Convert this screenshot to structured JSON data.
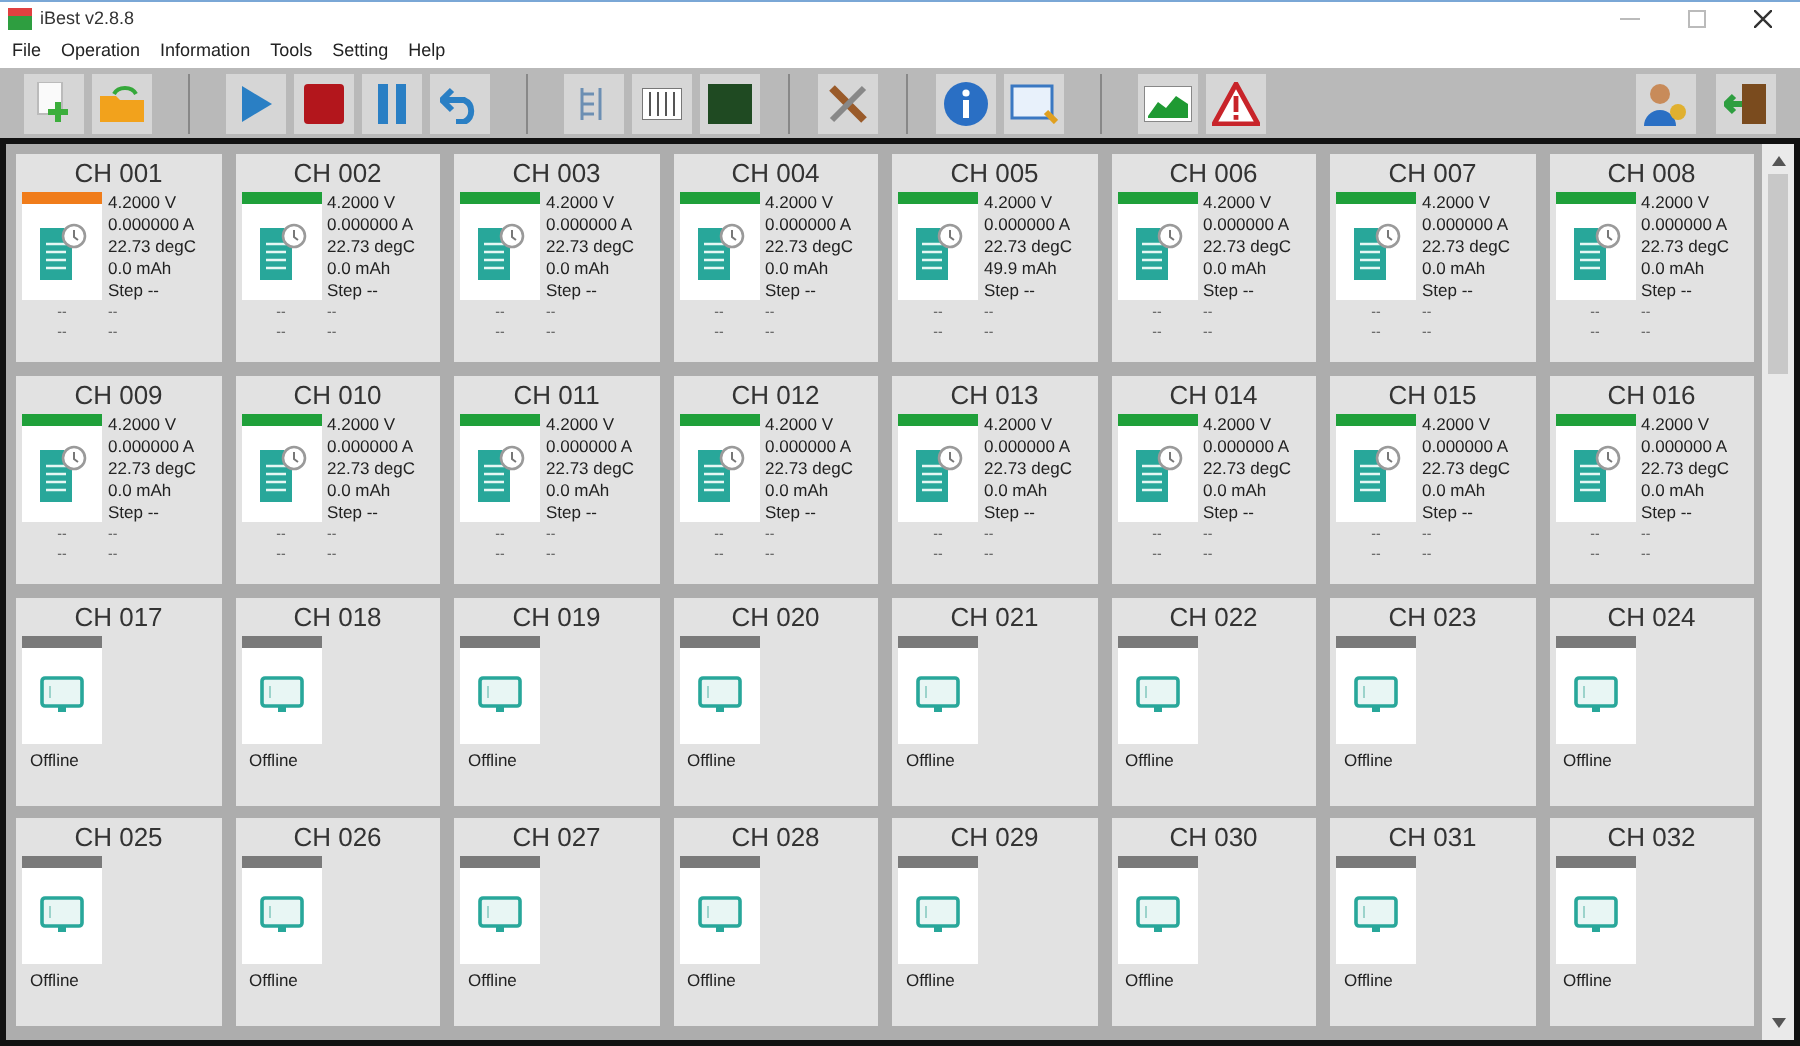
{
  "window": {
    "title": "iBest v2.8.8"
  },
  "menu": [
    "File",
    "Operation",
    "Information",
    "Tools",
    "Setting",
    "Help"
  ],
  "channels": [
    {
      "name": "CH 001",
      "kind": "online",
      "color": "#f07c1a",
      "lines": [
        "4.2000 V",
        "0.000000 A",
        "22.73 degC",
        "0.0 mAh",
        "Step --"
      ],
      "extra": [
        "--",
        "--",
        "--",
        "--"
      ]
    },
    {
      "name": "CH 002",
      "kind": "online",
      "color": "#1fa03a",
      "lines": [
        "4.2000 V",
        "0.000000 A",
        "22.73 degC",
        "0.0 mAh",
        "Step --"
      ],
      "extra": [
        "--",
        "--",
        "--",
        "--"
      ]
    },
    {
      "name": "CH 003",
      "kind": "online",
      "color": "#1fa03a",
      "lines": [
        "4.2000 V",
        "0.000000 A",
        "22.73 degC",
        "0.0 mAh",
        "Step --"
      ],
      "extra": [
        "--",
        "--",
        "--",
        "--"
      ]
    },
    {
      "name": "CH 004",
      "kind": "online",
      "color": "#1fa03a",
      "lines": [
        "4.2000 V",
        "0.000000 A",
        "22.73 degC",
        "0.0 mAh",
        "Step --"
      ],
      "extra": [
        "--",
        "--",
        "--",
        "--"
      ]
    },
    {
      "name": "CH 005",
      "kind": "online",
      "color": "#1fa03a",
      "lines": [
        "4.2000 V",
        "0.000000 A",
        "22.73 degC",
        "49.9 mAh",
        "Step --"
      ],
      "extra": [
        "--",
        "--",
        "--",
        "--"
      ]
    },
    {
      "name": "CH 006",
      "kind": "online",
      "color": "#1fa03a",
      "lines": [
        "4.2000 V",
        "0.000000 A",
        "22.73 degC",
        "0.0 mAh",
        "Step --"
      ],
      "extra": [
        "--",
        "--",
        "--",
        "--"
      ]
    },
    {
      "name": "CH 007",
      "kind": "online",
      "color": "#1fa03a",
      "lines": [
        "4.2000 V",
        "0.000000 A",
        "22.73 degC",
        "0.0 mAh",
        "Step --"
      ],
      "extra": [
        "--",
        "--",
        "--",
        "--"
      ]
    },
    {
      "name": "CH 008",
      "kind": "online",
      "color": "#1fa03a",
      "lines": [
        "4.2000 V",
        "0.000000 A",
        "22.73 degC",
        "0.0 mAh",
        "Step --"
      ],
      "extra": [
        "--",
        "--",
        "--",
        "--"
      ]
    },
    {
      "name": "CH 009",
      "kind": "online",
      "color": "#1fa03a",
      "lines": [
        "4.2000 V",
        "0.000000 A",
        "22.73 degC",
        "0.0 mAh",
        "Step --"
      ],
      "extra": [
        "--",
        "--",
        "--",
        "--"
      ]
    },
    {
      "name": "CH 010",
      "kind": "online",
      "color": "#1fa03a",
      "lines": [
        "4.2000 V",
        "0.000000 A",
        "22.73 degC",
        "0.0 mAh",
        "Step --"
      ],
      "extra": [
        "--",
        "--",
        "--",
        "--"
      ]
    },
    {
      "name": "CH 011",
      "kind": "online",
      "color": "#1fa03a",
      "lines": [
        "4.2000 V",
        "0.000000 A",
        "22.73 degC",
        "0.0 mAh",
        "Step --"
      ],
      "extra": [
        "--",
        "--",
        "--",
        "--"
      ]
    },
    {
      "name": "CH 012",
      "kind": "online",
      "color": "#1fa03a",
      "lines": [
        "4.2000 V",
        "0.000000 A",
        "22.73 degC",
        "0.0 mAh",
        "Step --"
      ],
      "extra": [
        "--",
        "--",
        "--",
        "--"
      ]
    },
    {
      "name": "CH 013",
      "kind": "online",
      "color": "#1fa03a",
      "lines": [
        "4.2000 V",
        "0.000000 A",
        "22.73 degC",
        "0.0 mAh",
        "Step --"
      ],
      "extra": [
        "--",
        "--",
        "--",
        "--"
      ]
    },
    {
      "name": "CH 014",
      "kind": "online",
      "color": "#1fa03a",
      "lines": [
        "4.2000 V",
        "0.000000 A",
        "22.73 degC",
        "0.0 mAh",
        "Step --"
      ],
      "extra": [
        "--",
        "--",
        "--",
        "--"
      ]
    },
    {
      "name": "CH 015",
      "kind": "online",
      "color": "#1fa03a",
      "lines": [
        "4.2000 V",
        "0.000000 A",
        "22.73 degC",
        "0.0 mAh",
        "Step --"
      ],
      "extra": [
        "--",
        "--",
        "--",
        "--"
      ]
    },
    {
      "name": "CH 016",
      "kind": "online",
      "color": "#1fa03a",
      "lines": [
        "4.2000 V",
        "0.000000 A",
        "22.73 degC",
        "0.0 mAh",
        "Step --"
      ],
      "extra": [
        "--",
        "--",
        "--",
        "--"
      ]
    },
    {
      "name": "CH 017",
      "kind": "offline",
      "color": "#7a7a7a",
      "status": "Offline"
    },
    {
      "name": "CH 018",
      "kind": "offline",
      "color": "#7a7a7a",
      "status": "Offline"
    },
    {
      "name": "CH 019",
      "kind": "offline",
      "color": "#7a7a7a",
      "status": "Offline"
    },
    {
      "name": "CH 020",
      "kind": "offline",
      "color": "#7a7a7a",
      "status": "Offline"
    },
    {
      "name": "CH 021",
      "kind": "offline",
      "color": "#7a7a7a",
      "status": "Offline"
    },
    {
      "name": "CH 022",
      "kind": "offline",
      "color": "#7a7a7a",
      "status": "Offline"
    },
    {
      "name": "CH 023",
      "kind": "offline",
      "color": "#7a7a7a",
      "status": "Offline"
    },
    {
      "name": "CH 024",
      "kind": "offline",
      "color": "#7a7a7a",
      "status": "Offline"
    },
    {
      "name": "CH 025",
      "kind": "offline",
      "color": "#7a7a7a",
      "status": "Offline"
    },
    {
      "name": "CH 026",
      "kind": "offline",
      "color": "#7a7a7a",
      "status": "Offline"
    },
    {
      "name": "CH 027",
      "kind": "offline",
      "color": "#7a7a7a",
      "status": "Offline"
    },
    {
      "name": "CH 028",
      "kind": "offline",
      "color": "#7a7a7a",
      "status": "Offline"
    },
    {
      "name": "CH 029",
      "kind": "offline",
      "color": "#7a7a7a",
      "status": "Offline"
    },
    {
      "name": "CH 030",
      "kind": "offline",
      "color": "#7a7a7a",
      "status": "Offline"
    },
    {
      "name": "CH 031",
      "kind": "offline",
      "color": "#7a7a7a",
      "status": "Offline"
    },
    {
      "name": "CH 032",
      "kind": "offline",
      "color": "#7a7a7a",
      "status": "Offline"
    }
  ]
}
